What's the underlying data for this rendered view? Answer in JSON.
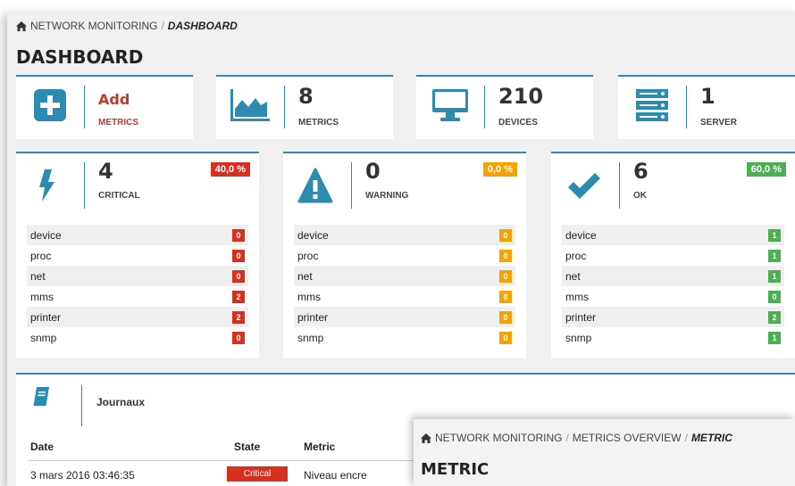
{
  "breadcrumb": {
    "root": "NETWORK MONITORING",
    "sep": "/",
    "current": "DASHBOARD"
  },
  "page_title": "DASHBOARD",
  "stats": {
    "add": {
      "value": "Add",
      "label": "METRICS",
      "icon": "plus-square-icon"
    },
    "metrics": {
      "value": "8",
      "label": "METRICS",
      "icon": "area-chart-icon"
    },
    "devices": {
      "value": "210",
      "label": "DEVICES",
      "icon": "monitor-icon"
    },
    "server": {
      "value": "1",
      "label": "SERVER",
      "icon": "server-icon"
    }
  },
  "status": {
    "critical": {
      "value": "4",
      "label": "CRITICAL",
      "pct": "40,0 %",
      "icon": "bolt-icon",
      "color": "#d7301f",
      "rows": [
        {
          "name": "device",
          "count": "0"
        },
        {
          "name": "proc",
          "count": "0"
        },
        {
          "name": "net",
          "count": "0"
        },
        {
          "name": "mms",
          "count": "2"
        },
        {
          "name": "printer",
          "count": "2"
        },
        {
          "name": "snmp",
          "count": "0"
        }
      ]
    },
    "warning": {
      "value": "0",
      "label": "WARNING",
      "pct": "0,0 %",
      "icon": "warning-triangle-icon",
      "color": "#f5a300",
      "rows": [
        {
          "name": "device",
          "count": "0"
        },
        {
          "name": "proc",
          "count": "0"
        },
        {
          "name": "net",
          "count": "0"
        },
        {
          "name": "mms",
          "count": "0"
        },
        {
          "name": "printer",
          "count": "0"
        },
        {
          "name": "snmp",
          "count": "0"
        }
      ]
    },
    "ok": {
      "value": "6",
      "label": "OK",
      "pct": "60,0 %",
      "icon": "checkmark-icon",
      "color": "#4caf50",
      "rows": [
        {
          "name": "device",
          "count": "1"
        },
        {
          "name": "proc",
          "count": "1"
        },
        {
          "name": "net",
          "count": "1"
        },
        {
          "name": "mms",
          "count": "0"
        },
        {
          "name": "printer",
          "count": "2"
        },
        {
          "name": "snmp",
          "count": "1"
        }
      ]
    }
  },
  "logs": {
    "title": "Journaux",
    "icon": "book-icon",
    "columns": {
      "date": "Date",
      "state": "State",
      "metric": "Metric"
    },
    "rows": [
      {
        "date": "3 mars 2016 03:46:35",
        "state": "Critical",
        "metric": "Niveau encre"
      }
    ]
  },
  "overlay": {
    "breadcrumb": {
      "root": "NETWORK MONITORING",
      "sep": "/",
      "middle": "METRICS OVERVIEW",
      "current": "METRIC"
    },
    "title": "METRIC"
  },
  "colors": {
    "accent": "#2c8bb0",
    "critical": "#d7301f",
    "warning": "#f5a300",
    "ok": "#4caf50"
  }
}
